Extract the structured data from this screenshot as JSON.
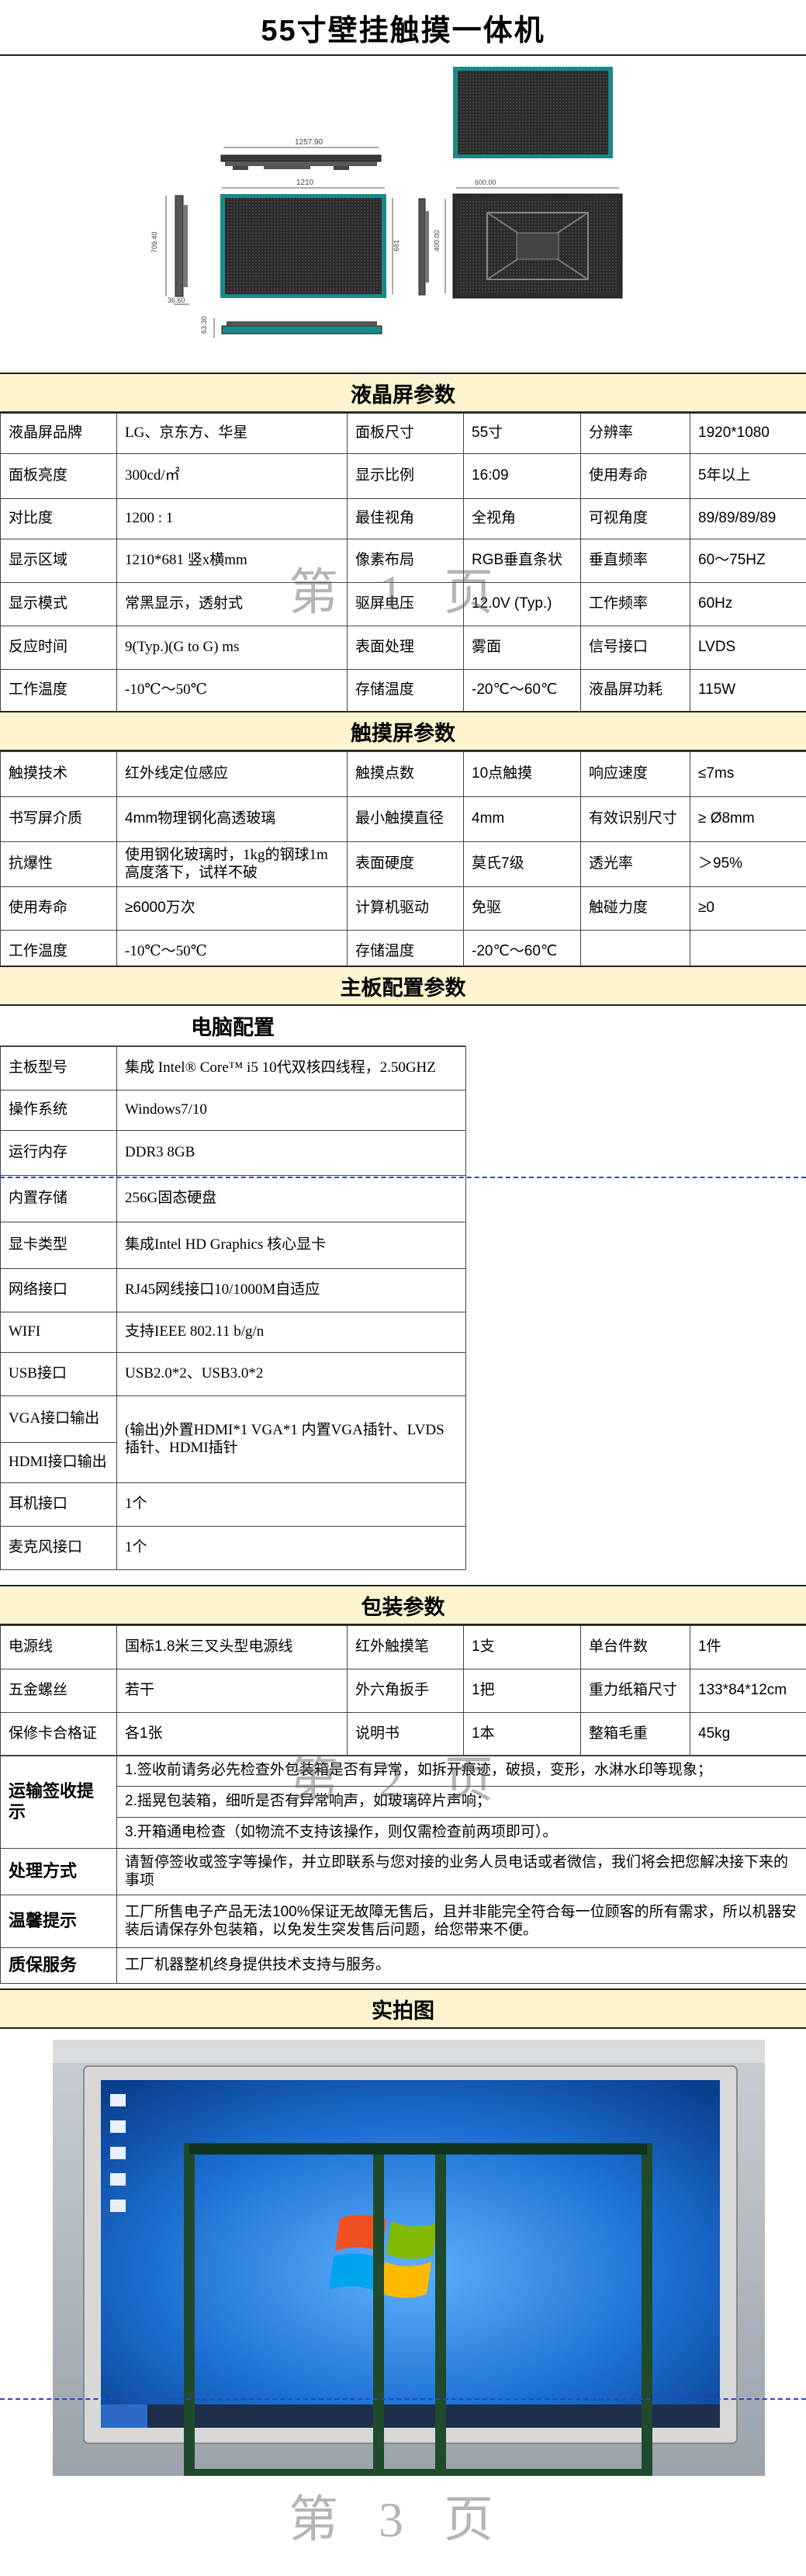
{
  "title": "55寸壁挂触摸一体机",
  "drawing": {
    "dim_width_total": "1257.90",
    "dim_width_inner": "1210",
    "dim_height_total": "709.40",
    "dim_height_inner": "681",
    "dim_side_depth": "36.60",
    "dim_back_width": "600.00",
    "dim_back_height": "400.00",
    "dim_bottom_depth": "63.30"
  },
  "lcd": {
    "heading": "液晶屏参数",
    "rows": [
      [
        "液晶屏品牌",
        "LG、京东方、华星",
        "面板尺寸",
        "55寸",
        "分辨率",
        "1920*1080"
      ],
      [
        "面板亮度",
        "300cd/㎡",
        "显示比例",
        "16:09",
        "使用寿命",
        "5年以上"
      ],
      [
        "对比度",
        "1200 : 1",
        "最佳视角",
        "全视角",
        "可视角度",
        "89/89/89/89"
      ],
      [
        "显示区域",
        "1210*681 竖x横mm",
        "像素布局",
        "RGB垂直条状",
        "垂直频率",
        "60～75HZ"
      ],
      [
        "显示模式",
        "常黑显示，透射式",
        "驱屏电压",
        "12.0V (Typ.)",
        "工作频率",
        "60Hz"
      ],
      [
        "反应时间",
        "9(Typ.)(G to G) ms",
        "表面处理",
        "雾面",
        "信号接口",
        "LVDS"
      ],
      [
        "工作温度",
        "-10℃～50℃",
        "存储温度",
        "-20℃～60℃",
        "液晶屏功耗",
        "115W"
      ]
    ]
  },
  "touch": {
    "heading": "触摸屏参数",
    "rows": [
      [
        "触摸技术",
        "红外线定位感应",
        "触摸点数",
        "10点触摸",
        "响应速度",
        "≤7ms"
      ],
      [
        "书写屏介质",
        "4mm物理钢化高透玻璃",
        "最小触摸直径",
        "4mm",
        "有效识别尺寸",
        "≥ Ø8mm"
      ],
      [
        "抗爆性",
        "使用钢化玻璃时，1kg的钢球1m高度落下，试样不破",
        "表面硬度",
        "莫氏7级",
        "透光率",
        "＞95%"
      ],
      [
        "使用寿命",
        "≥6000万次",
        "计算机驱动",
        "免驱",
        "触碰力度",
        "≥0"
      ],
      [
        "工作温度",
        "-10℃～50℃",
        "存储温度",
        "-20℃～60℃",
        "",
        ""
      ]
    ]
  },
  "mainboard": {
    "heading": "主板配置参数",
    "sub_heading": "电脑配置",
    "rows": [
      [
        "主板型号",
        "集成 Intel® Core™ i5 10代双核四线程，2.50GHZ"
      ],
      [
        "操作系统",
        "Windows7/10"
      ],
      [
        "运行内存",
        "DDR3 8GB"
      ],
      [
        "内置存储",
        "256G固态硬盘"
      ],
      [
        "显卡类型",
        "集成Intel HD Graphics 核心显卡"
      ],
      [
        "网络接口",
        "RJ45网线接口10/1000M自适应"
      ],
      [
        "WIFI",
        "支持IEEE 802.11 b/g/n"
      ],
      [
        "USB接口",
        "USB2.0*2、USB3.0*2"
      ],
      [
        "VGA接口输出",
        "(输出)外置HDMI*1 VGA*1                    内置VGA插针、LVDS插针、HDMI插针"
      ],
      [
        "HDMI接口输出",
        ""
      ],
      [
        "耳机接口",
        "1个"
      ],
      [
        "麦克风接口",
        "1个"
      ]
    ]
  },
  "package": {
    "heading": "包装参数",
    "rows": [
      [
        "电源线",
        "国标1.8米三叉头型电源线",
        "红外触摸笔",
        "1支",
        "单台件数",
        "1件"
      ],
      [
        "五金螺丝",
        "若干",
        "外六角扳手",
        "1把",
        "重力纸箱尺寸",
        "133*84*12cm"
      ],
      [
        "保修卡合格证",
        "各1张",
        "说明书",
        "1本",
        "整箱毛重",
        "45kg"
      ]
    ],
    "sign_label": "运输签收提示",
    "sign_lines": [
      "1.签收前请务必先检查外包装箱是否有异常，如拆开痕迹，破损，变形，水淋水印等现象；",
      "2.摇晃包装箱，细听是否有异常响声，如玻璃碎片声响；",
      "3.开箱通电检查（如物流不支持该操作，则仅需检查前两项即可）。"
    ],
    "handle_label": "处理方式",
    "handle_text": "请暂停签收或签字等操作，并立即联系与您对接的业务人员电话或者微信，我们将会把您解决接下来的事项",
    "warm_label": "温馨提示",
    "warm_text": "工厂所售电子产品无法100%保证无故障无售后，且并非能完全符合每一位顾客的所有需求，所以机器安装后请保存外包装箱，以免发生突发售后问题，给您带来不便。",
    "service_label": "质保服务",
    "service_text": "工厂机器整机终身提供技术支持与服务。"
  },
  "photo_heading": "实拍图",
  "watermarks": [
    "第 1 页",
    "第 2 页",
    "第 3 页"
  ]
}
